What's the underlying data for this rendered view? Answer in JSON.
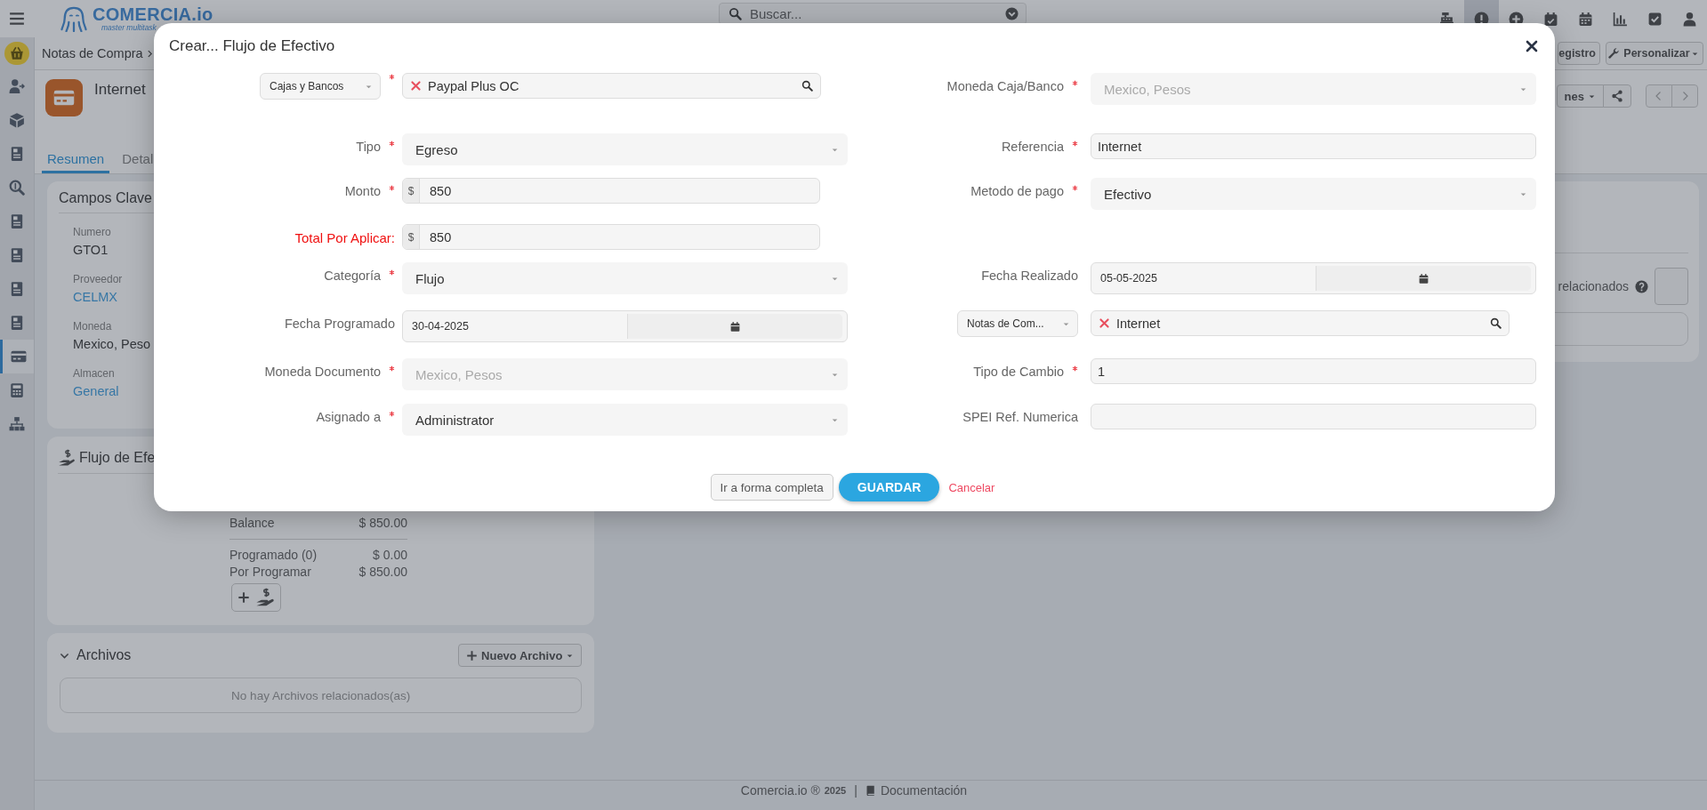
{
  "top_bar": {
    "logo": {
      "name": "COMERCIA.io",
      "tagline": "master multitask"
    },
    "search": {
      "placeholder": "Buscar..."
    },
    "toolbar": [
      {
        "selected": false
      },
      {
        "selected": true
      },
      {
        "selected": false
      },
      {
        "selected": false
      },
      {
        "selected": false
      },
      {
        "selected": false
      },
      {
        "selected": false
      },
      {
        "selected": false
      }
    ]
  },
  "sidebar": {
    "items": [
      {
        "selected": false
      },
      {
        "selected": false
      },
      {
        "selected": false
      },
      {
        "selected": false
      },
      {
        "selected": false
      },
      {
        "selected": false
      },
      {
        "selected": false
      },
      {
        "selected": false
      },
      {
        "selected": false
      },
      {
        "selected": true
      },
      {
        "selected": false
      },
      {
        "selected": false
      }
    ]
  },
  "breadcrumb": {
    "items": [
      "Notas de Compra"
    ],
    "buttons": [
      "egistro",
      "Personalizar"
    ]
  },
  "record": {
    "title": "Internet",
    "tabs": [
      {
        "label": "Resumen",
        "selected": true
      },
      {
        "label": "Detal",
        "selected": false
      }
    ],
    "actions_dropdown": "nes"
  },
  "key_fields": {
    "title": "Campos Clave",
    "fields": [
      {
        "label": "Numero",
        "value": "GTO1",
        "kind": "text"
      },
      {
        "label": "Proveedor",
        "value": "CELMX",
        "kind": "link"
      },
      {
        "label": "Moneda",
        "value": "Mexico, Peso",
        "kind": "text"
      },
      {
        "label": "Almacen",
        "value": "General",
        "kind": "link"
      }
    ]
  },
  "side_panel": {
    "label": "relacionados"
  },
  "cash_flow": {
    "title": "Flujo de Efe",
    "rows": [
      {
        "label": "Balance",
        "value": "$ 850.00"
      },
      {
        "label": "Programado (0)",
        "value": "$ 0.00"
      },
      {
        "label": "Por Programar",
        "value": "$ 850.00"
      }
    ]
  },
  "files": {
    "title": "Archivos",
    "expanded": true,
    "button": "Nuevo Archivo",
    "empty": "No hay Archivos relacionados(as)"
  },
  "footer": {
    "brand": "Comercia.io ®",
    "year": "2025",
    "separator": "|",
    "link": "Documentación"
  },
  "modal": {
    "title": "Crear... Flujo de Efectivo",
    "rows": [
      {
        "left": {
          "prefix_select": "Cajas y Bancos",
          "required": true,
          "kind": "search",
          "value": "Paypal Plus OC",
          "disabled": false
        },
        "right": {
          "label": "Moneda Caja/Banco",
          "required": true,
          "kind": "select",
          "value": "Mexico, Pesos",
          "disabled": true
        }
      },
      {
        "left": {
          "label": "Tipo",
          "required": true,
          "kind": "select",
          "value": "Egreso",
          "disabled": false
        },
        "right": {
          "label": "Referencia",
          "required": true,
          "kind": "text",
          "value": "Internet",
          "disabled": false
        }
      },
      {
        "left": {
          "label": "Monto",
          "required": true,
          "kind": "money",
          "prefix": "$",
          "value": "850",
          "disabled": false
        },
        "right": {
          "label": "Metodo de pago",
          "required": true,
          "kind": "select",
          "value": "Efectivo",
          "disabled": false
        }
      },
      {
        "left": {
          "label": "Total Por Aplicar:",
          "highlight": true,
          "required": false,
          "kind": "money",
          "prefix": "$",
          "value": "850",
          "disabled": false
        }
      },
      {
        "left": {
          "label": "Categoría",
          "required": true,
          "kind": "select",
          "value": "Flujo",
          "disabled": false
        },
        "right": {
          "label": "Fecha Realizado",
          "required": false,
          "kind": "date",
          "value": "05-05-2025",
          "disabled": false
        }
      },
      {
        "left": {
          "label": "Fecha Programado",
          "required": false,
          "kind": "date",
          "value": "30-04-2025",
          "disabled": false
        },
        "right": {
          "prefix_select": "Notas de Com...",
          "required": false,
          "kind": "search",
          "value": "Internet",
          "disabled": false
        }
      },
      {
        "left": {
          "label": "Moneda Documento",
          "required": true,
          "kind": "select",
          "value": "Mexico, Pesos",
          "disabled": true
        },
        "right": {
          "label": "Tipo de Cambio",
          "required": true,
          "kind": "text",
          "value": "1",
          "disabled": false
        }
      },
      {
        "left": {
          "label": "Asignado a",
          "required": true,
          "kind": "select",
          "value": "Administrator",
          "disabled": false
        },
        "right": {
          "label": "SPEI Ref. Numerica",
          "required": false,
          "kind": "text",
          "disabled": false
        }
      }
    ],
    "buttons": [
      {
        "label": "Ir a forma completa",
        "kind": "secondary"
      },
      {
        "label": "GUARDAR",
        "kind": "primary"
      },
      {
        "label": "Cancelar",
        "kind": "link"
      }
    ]
  }
}
